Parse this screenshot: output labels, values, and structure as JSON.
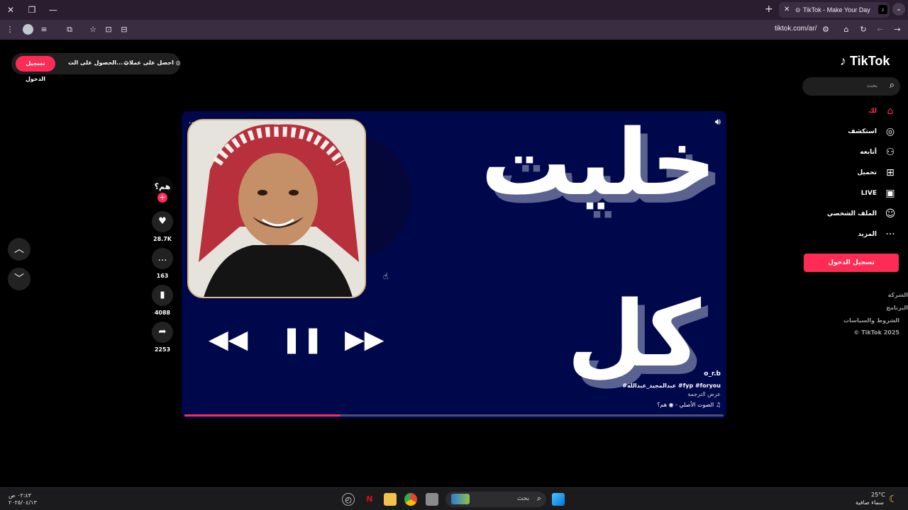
{
  "browser": {
    "tab_title": "TikTok - Make Your Day",
    "tab_favicon": "tiktok-icon",
    "url": "tiktok.com/ar/",
    "new_tab_label": "+",
    "window_controls": [
      "close-icon",
      "restore-icon",
      "minimize-icon"
    ]
  },
  "topbar": {
    "login_label": "تسجيل الدخول",
    "get_app_label": "الحصول على الت...",
    "coins_label": "احصل على عملات"
  },
  "logo": {
    "text": "TikTok"
  },
  "search": {
    "placeholder": "بحث"
  },
  "nav": [
    {
      "label": "لك",
      "icon": "home-icon",
      "active": true
    },
    {
      "label": "استكشف",
      "icon": "compass-icon",
      "active": false
    },
    {
      "label": "أتابعه",
      "icon": "following-icon",
      "active": false
    },
    {
      "label": "تحميل",
      "icon": "upload-icon",
      "active": false
    },
    {
      "label": "LIVE",
      "icon": "live-icon",
      "active": false
    },
    {
      "label": "الملف الشخصي",
      "icon": "profile-icon",
      "active": false
    },
    {
      "label": "المزيد",
      "icon": "more-icon",
      "active": false
    }
  ],
  "sidebar_login_label": "تسجيل الدخول",
  "footer_links": [
    "الشركة",
    "البرنامج",
    "الشروط والسياسات",
    "© TikTok 2025"
  ],
  "video": {
    "word_top": "خليت",
    "word_bottom": "كل",
    "username": "o_r.b",
    "caption": "#عبدالمجيد_عبدالله #fyp #foryou",
    "translate_label": "عرض الترجمة",
    "sound": "الصوت الأصلي - ◉ هم؟",
    "progress": 0.29
  },
  "author": {
    "avatar_text": "هم؟"
  },
  "actions": [
    {
      "icon": "heart-icon",
      "count": "28.7K"
    },
    {
      "icon": "comment-icon",
      "count": "163"
    },
    {
      "icon": "bookmark-icon",
      "count": "4088"
    },
    {
      "icon": "share-icon",
      "count": "2253"
    }
  ],
  "taskbar": {
    "time": "٠٢:٤٣ ص",
    "date": "٢٠٢٥/٠٤/١٣",
    "search_placeholder": "بحث",
    "temperature": "25°C",
    "weather": "سماء صافية"
  }
}
